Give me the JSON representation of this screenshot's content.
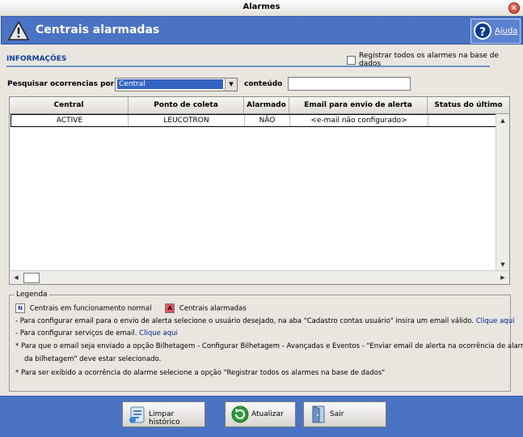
{
  "window": {
    "title": "Alarmes"
  },
  "banner": {
    "heading": "Centrais alarmadas",
    "help_label": "Ajuda"
  },
  "info": {
    "section_label": "INFORMAÇÕES",
    "register_all_label": "Registrar todos os alarmes na base de dados",
    "register_all_checked": false
  },
  "search": {
    "label": "Pesquisar ocorrencias por",
    "selected": "Central",
    "content_label": "conteúdo",
    "content_value": ""
  },
  "grid": {
    "columns": [
      "Central",
      "Ponto de coleta",
      "Alarmado",
      "Email para envio de alerta",
      "Status do último"
    ],
    "rows": [
      [
        "ACTIVE",
        "LEUCOTRON",
        "NÃO",
        "<e-mail não configurado>",
        ""
      ]
    ]
  },
  "legend": {
    "title": "Legenda",
    "normal_badge": "N",
    "normal_label": "Centrais em funcionamento normal",
    "alarm_badge": "A",
    "alarm_label": "Centrais alarmadas",
    "line1": "- Para configurar email para o envio de alerta selecione o usuário desejado, na aba \"Cadastro contas usuário\" insira um email válido.",
    "line1_link": "Clique aqui",
    "line2": "- Para configurar serviços de email.",
    "line2_link": "Clique aqui",
    "line3": "* Para que o email seja enviado a opção Bilhetagem - Configurar Bilhetagem - Avançadas e Eventos - \"Enviar email de alerta na ocorrência de alarmes",
    "line3b": "da bilhetagem\" deve estar selecionado.",
    "line4": "* Para ser exibido a ocorrência do alarme selecione  a opção \"Registrar todos os alarmes na base de dados\""
  },
  "buttons": {
    "clear": "Limpar histórico",
    "refresh": "Atualizar",
    "exit": "Sair"
  },
  "colors": {
    "banner": "#4a73c4",
    "section": "#0c3fa0",
    "alarm_badge": "#e2526a",
    "normal_badge_text": "#1a2fa0"
  }
}
